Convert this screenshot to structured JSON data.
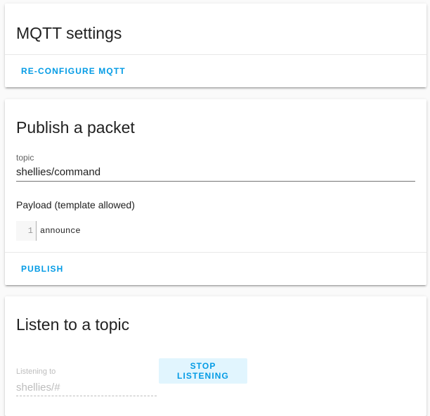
{
  "mqtt_settings": {
    "title": "MQTT settings",
    "reconfigure_label": "RE-CONFIGURE MQTT"
  },
  "publish": {
    "title": "Publish a packet",
    "topic_label": "topic",
    "topic_value": "shellies/command",
    "payload_label": "Payload (template allowed)",
    "payload_line_number": "1",
    "payload_code": "announce",
    "publish_label": "PUBLISH"
  },
  "listen": {
    "title": "Listen to a topic",
    "listening_label": "Listening to",
    "listening_value": "shellies/#",
    "stop_label": "STOP LISTENING"
  },
  "colors": {
    "accent": "#039be5",
    "accent_bg": "#e1f5fe",
    "background": "#fafafa",
    "card": "#ffffff"
  }
}
